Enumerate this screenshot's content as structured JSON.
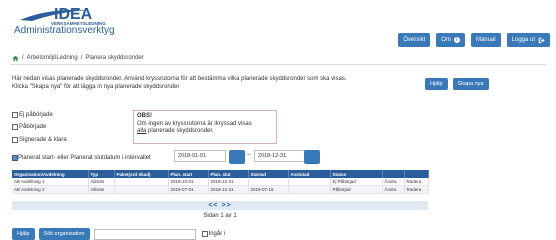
{
  "header": {
    "logo_main": "IDEA",
    "logo_sub": "VERKSAMHETSLEDNING",
    "app_title": "Administrationsverktyg",
    "nav": [
      {
        "label": "Översikt",
        "icon": "none"
      },
      {
        "label": "Om",
        "icon": "info-icon"
      },
      {
        "label": "Manual",
        "icon": "none"
      },
      {
        "label": "Logga ut",
        "icon": "logout-icon"
      }
    ]
  },
  "breadcrumb": {
    "items": [
      "ArbetsmiljöLedning",
      "Planera skyddsronder"
    ],
    "separator": "/"
  },
  "intro": {
    "line1": "Här nedan visas planerade skyddsronder. Använd kryssrutorna för att bestämma vilka planerade skyddsronder som ska visas.",
    "line2": "Klicka \"Skapa nya\" för att lägga in nya planerade skyddsronder"
  },
  "actions": {
    "help_label": "Hjälp",
    "create_label": "Skapa nya"
  },
  "filters": [
    {
      "label": "Ej påbörjade",
      "checked": false
    },
    {
      "label": "Påbörjade",
      "checked": false
    },
    {
      "label": "Signerade & klara",
      "checked": false
    }
  ],
  "notice": {
    "title": "OBS!",
    "line1": "Om ingen av kryssrutorna är ikryssad visas",
    "line2_em": "alla",
    "line2_rest": " planerade skyddsronder."
  },
  "date_filter": {
    "label": "Planerat start- eller Planerat slutdatum i intervallet",
    "checked": true,
    "from": "2018-01-01",
    "separator": "--",
    "to": "2018-12-31"
  },
  "table": {
    "columns": [
      "Organisation/Avdelning",
      "Typ",
      "Paket(ord ökad)",
      "Plan. start",
      "Plan. slut",
      "Startad",
      "Avslutad",
      "Status",
      "",
      ""
    ],
    "rows": [
      [
        "AB Avdelning 1",
        "Allmän",
        "",
        "2018-10-01",
        "2018-12-31",
        "",
        "",
        "Ej Påbörjad",
        "Ändra",
        "Radera"
      ],
      [
        "AB Avdelning 2",
        "Allmän",
        "",
        "2018-07-01",
        "2018-12-31",
        "2018-07-16",
        "",
        "Påbörjad",
        "Ändra",
        "Radera"
      ]
    ]
  },
  "pager": {
    "arrows": "<< >>",
    "info": "Sidan 1 av 1"
  },
  "bottom": {
    "help_label": "Hjälp",
    "search_label": "Sök organisation",
    "search_value": "",
    "include_label": "Ingår i",
    "include_checked": false
  },
  "colors": {
    "primary": "#3a79b8",
    "header_row": "#2a5d9a",
    "title": "#2a5d9a"
  }
}
